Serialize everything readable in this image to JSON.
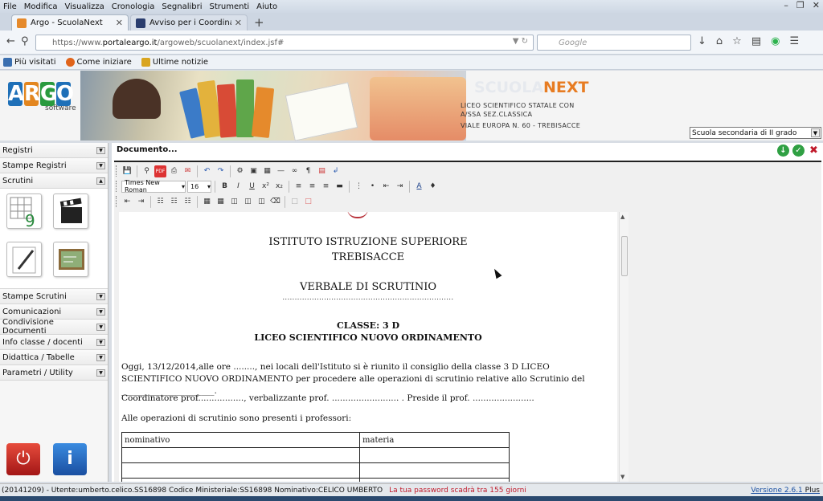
{
  "menu": [
    "File",
    "Modifica",
    "Visualizza",
    "Cronologia",
    "Segnalibri",
    "Strumenti",
    "Aiuto"
  ],
  "tabs": [
    {
      "title": "Argo - ScuolaNext",
      "active": true
    },
    {
      "title": "Avviso per i Coordinatori d...",
      "active": false
    }
  ],
  "url": {
    "prefix": "https://www.",
    "domain": "portaleargo.it",
    "path": "/argoweb/scuolanext/index.jsf#"
  },
  "search": {
    "placeholder": "Google"
  },
  "bookmarks": [
    "Più visitati",
    "Come iniziare",
    "Ultime notizie"
  ],
  "banner": {
    "logo_letters": [
      "A",
      "R",
      "G",
      "O"
    ],
    "logo_sub": "software",
    "product_a": "SCUOLA",
    "product_b": "NEXT",
    "school_line1": "LICEO SCIENTIFICO STATALE CON",
    "school_line2": "A/SSA SEZ.CLASSICA",
    "school_line3": "VIALE EUROPA N. 60 - TREBISACCE",
    "school_type": "Scuola secondaria di II grado"
  },
  "sidebar": {
    "top_items": [
      "Registri",
      "Stampe Registri",
      "Scrutini"
    ],
    "bottom_items": [
      "Stampe Scrutini",
      "Comunicazioni",
      "Condivisione Documenti",
      "Info classe / docenti",
      "Didattica / Tabelle",
      "Parametri / Utility"
    ]
  },
  "document": {
    "title": "Documento...",
    "font": "Times New Roman",
    "size": "16",
    "line1": "ISTITUTO ISTRUZIONE SUPERIORE",
    "line2": "TREBISACCE",
    "verbale": "VERBALE DI SCRUTINIO",
    "dots": "......................................................................",
    "classe": "CLASSE: 3 D",
    "liceo": "LICEO SCIENTIFICO NUOVO ORDINAMENTO",
    "para1": "Oggi, 13/12/2014,alle ore ........, nei locali dell'Istituto si è riunito il consiglio della classe 3 D LICEO SCIENTIFICO NUOVO ORDINAMENTO per procedere alle operazioni di scrutinio relative allo Scrutinio del ______________________.",
    "para2": "Coordinatore prof................., verbalizzante prof. ......................... . Preside il prof. .......................",
    "para3": "Alle operazioni di scrutinio sono presenti i professori:",
    "table_headers": [
      "nominativo",
      "materia"
    ]
  },
  "status": {
    "user": "(20141209) - Utente:umberto.celico.SS16898 Codice Ministeriale:SS16898 Nominativo:CELICO UMBERTO",
    "warning": "La tua password scadrà tra 155 giorni",
    "version": "Versione 2.6.1",
    "plus": "Plus"
  }
}
